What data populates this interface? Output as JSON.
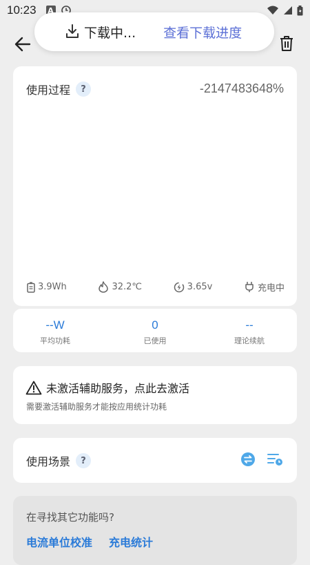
{
  "status_bar": {
    "time": "10:23"
  },
  "toast": {
    "downloading": "下载中...",
    "view_progress": "查看下载进度"
  },
  "usage": {
    "title": "使用过程",
    "help": "?",
    "percent": "-2147483648%",
    "energy": "3.9Wh",
    "temperature": "32.2℃",
    "voltage": "3.65v",
    "charging": "充电中"
  },
  "stats": {
    "avg_power": {
      "value": "--W",
      "label": "平均功耗"
    },
    "used": {
      "value": "0",
      "label": "已使用"
    },
    "endurance": {
      "value": "--",
      "label": "理论续航"
    }
  },
  "warning": {
    "title": "未激活辅助服务，点此去激活",
    "desc": "需要激活辅助服务才能按应用统计功耗"
  },
  "scene": {
    "title": "使用场景",
    "help": "?"
  },
  "more": {
    "question": "在寻找其它功能吗?",
    "links": [
      "电流单位校准",
      "充电统计"
    ]
  },
  "colors": {
    "accent": "#2b7bd8",
    "link": "#5b6fd6",
    "scene_icon": "#4fa8e8"
  }
}
